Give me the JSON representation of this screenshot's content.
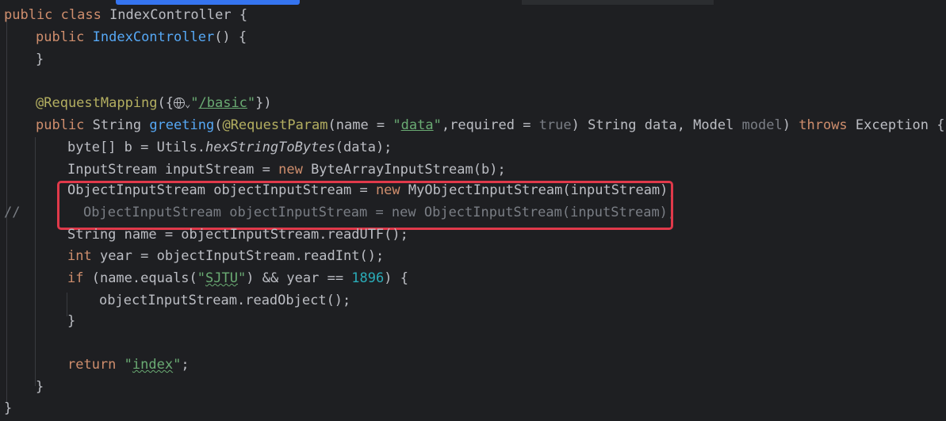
{
  "editor": {
    "lines": {
      "l1": {
        "kw": "public class ",
        "name": "IndexController",
        "rest": " {"
      },
      "l2": {
        "kw": "public ",
        "fn": "IndexController",
        "rest": "() {"
      },
      "l3": {
        "rest": "}"
      },
      "l5": {
        "ann": "@RequestMapping",
        "p1": "({",
        "q1": "\"",
        "path": "/basic",
        "q2": "\"",
        "p2": "})"
      },
      "l6": {
        "kw1": "public ",
        "type": "String ",
        "fn": "greeting",
        "p1": "(",
        "ann": "@RequestParam",
        "p2": "(name = ",
        "q1": "\"",
        "s1": "data",
        "q2": "\"",
        "p3": ",required = ",
        "kw2": "true",
        "p4": ") String data, Model ",
        "model": "model",
        "p5": ") ",
        "kw3": "throws",
        "p6": " Exception {"
      },
      "l7": {
        "a": "byte[] b = Utils.",
        "fn": "hexStringToBytes",
        "b": "(data);"
      },
      "l8": {
        "a": "InputStream inputStream = ",
        "kw": "new",
        "b": " ByteArrayInputStream(b);"
      },
      "l9": {
        "a": "ObjectInputStream objectInputStream = ",
        "kw": "new",
        "b": " MyObjectInputStream(inputStream);"
      },
      "l10": {
        "slash": "//",
        "text": "ObjectInputStream objectInputStream = new ObjectInputStream(inputStream);"
      },
      "l11": {
        "text": "String name = objectInputStream.readUTF();"
      },
      "l12": {
        "kw": "int",
        "b": " year = objectInputStream.readInt();"
      },
      "l13": {
        "kw": "if",
        "a": " (name.equals(",
        "q1": "\"",
        "s": "SJTU",
        "q2": "\"",
        "b": ") && year == ",
        "num": "1896",
        "c": ") {"
      },
      "l14": {
        "text": "objectInputStream.readObject();"
      },
      "l15": {
        "text": "}"
      },
      "l17": {
        "kw": "return",
        "a": " ",
        "q1": "\"",
        "s": "index",
        "q2": "\"",
        "b": ";"
      },
      "l18": {
        "text": "}"
      },
      "l19": {
        "text": "}"
      }
    }
  },
  "colors": {
    "background": "#1e1f22",
    "keyword": "#cf8e6d",
    "function": "#56a8f5",
    "annotation": "#b3ae60",
    "string": "#6aab73",
    "number": "#2aacb8",
    "highlight_border": "#e0394a",
    "scroll_thumb": "#3574f0"
  },
  "icons": [
    "globe-icon",
    "chevron-down-icon"
  ]
}
